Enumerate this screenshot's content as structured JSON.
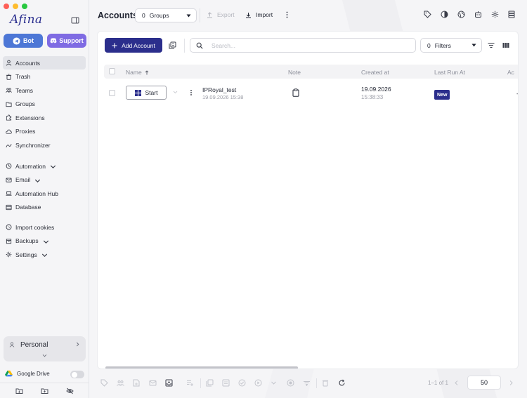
{
  "app": {
    "logo_text": "Afina"
  },
  "sidebar": {
    "bot_label": "Bot",
    "support_label": "Support",
    "nav_main": [
      {
        "label": "Accounts"
      },
      {
        "label": "Trash"
      },
      {
        "label": "Teams"
      },
      {
        "label": "Groups"
      },
      {
        "label": "Extensions"
      },
      {
        "label": "Proxies"
      },
      {
        "label": "Synchronizer"
      }
    ],
    "nav_tools": [
      {
        "label": "Automation"
      },
      {
        "label": "Email"
      },
      {
        "label": "Automation Hub"
      },
      {
        "label": "Database"
      }
    ],
    "nav_settings": [
      {
        "label": "Import cookies"
      },
      {
        "label": "Backups"
      },
      {
        "label": "Settings"
      }
    ],
    "workspace": "Personal",
    "google_drive_label": "Google Drive",
    "google_drive_enabled": false
  },
  "header": {
    "title": "Accounts",
    "groups_count": "0",
    "groups_label": "Groups",
    "export_label": "Export",
    "import_label": "Import"
  },
  "toolbar": {
    "add_account_label": "Add Account",
    "search_placeholder": "Search...",
    "search_value": "",
    "filters_count": "0",
    "filters_label": "Filters"
  },
  "table": {
    "columns": [
      "Name",
      "Note",
      "Created at",
      "Last Run At",
      "Ac"
    ],
    "sort": {
      "column": "Name",
      "direction": "asc"
    },
    "rows": [
      {
        "start_label": "Start",
        "name": "IPRoyal_test",
        "name_sub": "19.09.2026 15:38",
        "created_date": "19.09.2026",
        "created_time": "15:38:33",
        "last_run_badge": "New",
        "extra": "-"
      }
    ]
  },
  "footer": {
    "pagination": "1–1 of 1",
    "page_size": "50"
  },
  "colors": {
    "primary": "#2b2e8c",
    "bot": "#4d77d6",
    "support": "#7f6be3",
    "sidebar_bg": "#f5f5f7"
  }
}
